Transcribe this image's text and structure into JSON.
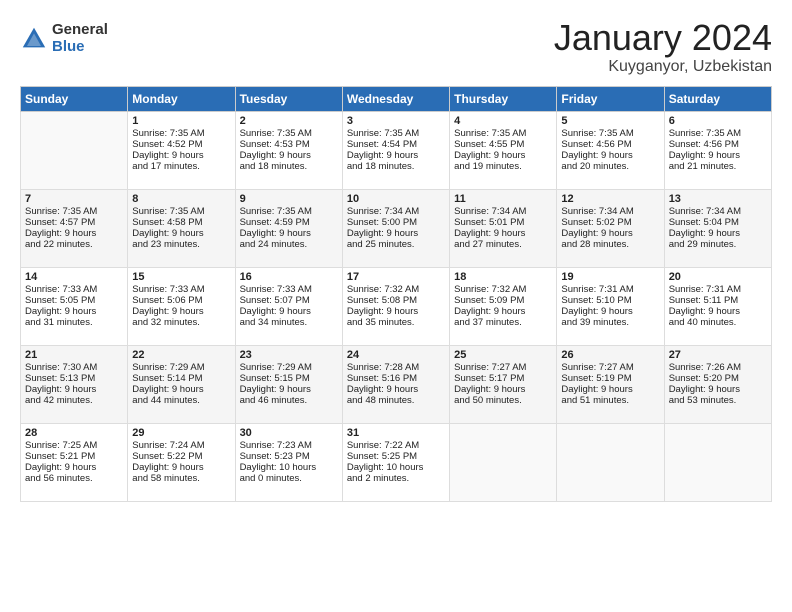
{
  "logo": {
    "general": "General",
    "blue": "Blue"
  },
  "title": "January 2024",
  "location": "Kuyganyor, Uzbekistan",
  "days_of_week": [
    "Sunday",
    "Monday",
    "Tuesday",
    "Wednesday",
    "Thursday",
    "Friday",
    "Saturday"
  ],
  "weeks": [
    [
      {
        "day": "",
        "info": ""
      },
      {
        "day": "1",
        "info": "Sunrise: 7:35 AM\nSunset: 4:52 PM\nDaylight: 9 hours\nand 17 minutes."
      },
      {
        "day": "2",
        "info": "Sunrise: 7:35 AM\nSunset: 4:53 PM\nDaylight: 9 hours\nand 18 minutes."
      },
      {
        "day": "3",
        "info": "Sunrise: 7:35 AM\nSunset: 4:54 PM\nDaylight: 9 hours\nand 18 minutes."
      },
      {
        "day": "4",
        "info": "Sunrise: 7:35 AM\nSunset: 4:55 PM\nDaylight: 9 hours\nand 19 minutes."
      },
      {
        "day": "5",
        "info": "Sunrise: 7:35 AM\nSunset: 4:56 PM\nDaylight: 9 hours\nand 20 minutes."
      },
      {
        "day": "6",
        "info": "Sunrise: 7:35 AM\nSunset: 4:56 PM\nDaylight: 9 hours\nand 21 minutes."
      }
    ],
    [
      {
        "day": "7",
        "info": "Sunrise: 7:35 AM\nSunset: 4:57 PM\nDaylight: 9 hours\nand 22 minutes."
      },
      {
        "day": "8",
        "info": "Sunrise: 7:35 AM\nSunset: 4:58 PM\nDaylight: 9 hours\nand 23 minutes."
      },
      {
        "day": "9",
        "info": "Sunrise: 7:35 AM\nSunset: 4:59 PM\nDaylight: 9 hours\nand 24 minutes."
      },
      {
        "day": "10",
        "info": "Sunrise: 7:34 AM\nSunset: 5:00 PM\nDaylight: 9 hours\nand 25 minutes."
      },
      {
        "day": "11",
        "info": "Sunrise: 7:34 AM\nSunset: 5:01 PM\nDaylight: 9 hours\nand 27 minutes."
      },
      {
        "day": "12",
        "info": "Sunrise: 7:34 AM\nSunset: 5:02 PM\nDaylight: 9 hours\nand 28 minutes."
      },
      {
        "day": "13",
        "info": "Sunrise: 7:34 AM\nSunset: 5:04 PM\nDaylight: 9 hours\nand 29 minutes."
      }
    ],
    [
      {
        "day": "14",
        "info": "Sunrise: 7:33 AM\nSunset: 5:05 PM\nDaylight: 9 hours\nand 31 minutes."
      },
      {
        "day": "15",
        "info": "Sunrise: 7:33 AM\nSunset: 5:06 PM\nDaylight: 9 hours\nand 32 minutes."
      },
      {
        "day": "16",
        "info": "Sunrise: 7:33 AM\nSunset: 5:07 PM\nDaylight: 9 hours\nand 34 minutes."
      },
      {
        "day": "17",
        "info": "Sunrise: 7:32 AM\nSunset: 5:08 PM\nDaylight: 9 hours\nand 35 minutes."
      },
      {
        "day": "18",
        "info": "Sunrise: 7:32 AM\nSunset: 5:09 PM\nDaylight: 9 hours\nand 37 minutes."
      },
      {
        "day": "19",
        "info": "Sunrise: 7:31 AM\nSunset: 5:10 PM\nDaylight: 9 hours\nand 39 minutes."
      },
      {
        "day": "20",
        "info": "Sunrise: 7:31 AM\nSunset: 5:11 PM\nDaylight: 9 hours\nand 40 minutes."
      }
    ],
    [
      {
        "day": "21",
        "info": "Sunrise: 7:30 AM\nSunset: 5:13 PM\nDaylight: 9 hours\nand 42 minutes."
      },
      {
        "day": "22",
        "info": "Sunrise: 7:29 AM\nSunset: 5:14 PM\nDaylight: 9 hours\nand 44 minutes."
      },
      {
        "day": "23",
        "info": "Sunrise: 7:29 AM\nSunset: 5:15 PM\nDaylight: 9 hours\nand 46 minutes."
      },
      {
        "day": "24",
        "info": "Sunrise: 7:28 AM\nSunset: 5:16 PM\nDaylight: 9 hours\nand 48 minutes."
      },
      {
        "day": "25",
        "info": "Sunrise: 7:27 AM\nSunset: 5:17 PM\nDaylight: 9 hours\nand 50 minutes."
      },
      {
        "day": "26",
        "info": "Sunrise: 7:27 AM\nSunset: 5:19 PM\nDaylight: 9 hours\nand 51 minutes."
      },
      {
        "day": "27",
        "info": "Sunrise: 7:26 AM\nSunset: 5:20 PM\nDaylight: 9 hours\nand 53 minutes."
      }
    ],
    [
      {
        "day": "28",
        "info": "Sunrise: 7:25 AM\nSunset: 5:21 PM\nDaylight: 9 hours\nand 56 minutes."
      },
      {
        "day": "29",
        "info": "Sunrise: 7:24 AM\nSunset: 5:22 PM\nDaylight: 9 hours\nand 58 minutes."
      },
      {
        "day": "30",
        "info": "Sunrise: 7:23 AM\nSunset: 5:23 PM\nDaylight: 10 hours\nand 0 minutes."
      },
      {
        "day": "31",
        "info": "Sunrise: 7:22 AM\nSunset: 5:25 PM\nDaylight: 10 hours\nand 2 minutes."
      },
      {
        "day": "",
        "info": ""
      },
      {
        "day": "",
        "info": ""
      },
      {
        "day": "",
        "info": ""
      }
    ]
  ]
}
